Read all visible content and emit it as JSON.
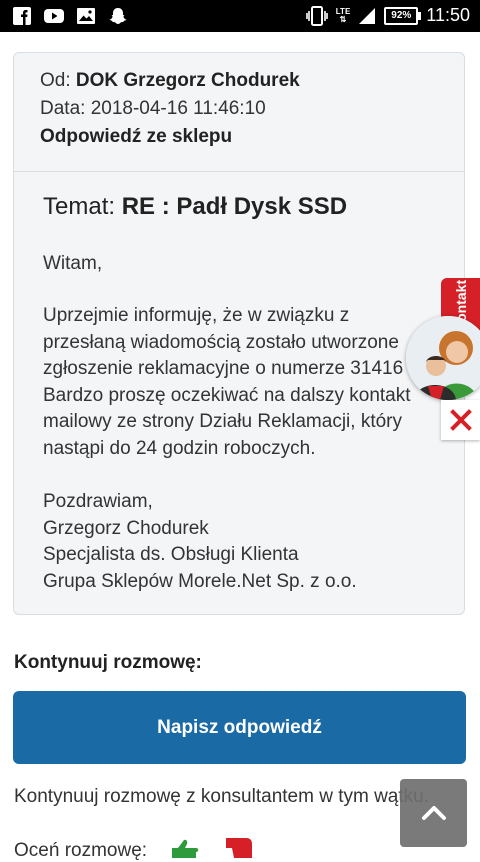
{
  "status_bar": {
    "time": "11:50",
    "battery": "92%",
    "network": "LTE",
    "icons": [
      "facebook-icon",
      "youtube-icon",
      "gallery-icon",
      "snapchat-icon",
      "vibrate-icon",
      "signal-icon",
      "battery-icon"
    ]
  },
  "message": {
    "from_label": "Od:",
    "from_value": "DOK Grzegorz Chodurek",
    "date_label": "Data:",
    "date_value": "2018-04-16 11:46:10",
    "reply_type": "Odpowiedź ze sklepu",
    "subject_label": "Temat:",
    "subject_value": "RE : Padł Dysk SSD",
    "greeting": "Witam,",
    "body_lines": [
      "Uprzejmie informuję, że w związku z",
      "przesłaną wiadomością zostało utworzone",
      "zgłoszenie reklamacyjne o numerze 31416",
      "Bardzo proszę oczekiwać na dalszy kontakt",
      "mailowy ze strony Działu Reklamacji, który",
      "nastąpi do 24 godzin roboczych."
    ],
    "signature_lines": [
      "Pozdrawiam,",
      "Grzegorz Chodurek",
      "Specjalista ds. Obsługi Klienta",
      "Grupa Sklepów Morele.Net Sp. z o.o."
    ]
  },
  "widget": {
    "tab_label": "Kontakt"
  },
  "continue": {
    "heading": "Kontynuuj rozmowę:",
    "button_label": "Napisz odpowiedź",
    "text": "Kontynuuj rozmowę z konsultantem w tym wątku.",
    "rating_label": "Oceń rozmowę:"
  },
  "colors": {
    "primary": "#1a6aa6",
    "accent_red": "#d52027",
    "card_bg": "#f3f5f7"
  }
}
